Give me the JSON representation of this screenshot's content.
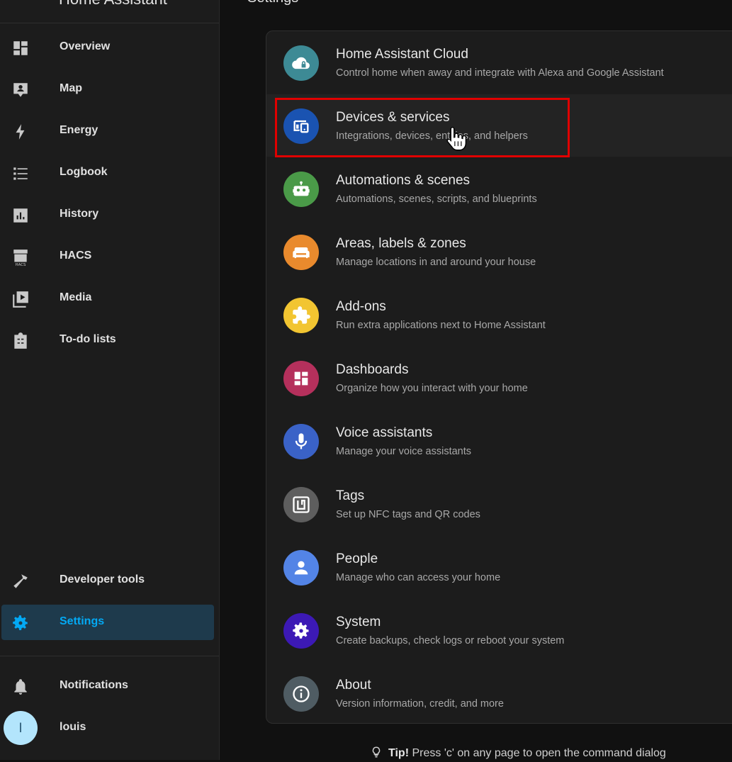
{
  "sidebar": {
    "title": "Home Assistant",
    "items": [
      {
        "label": "Overview",
        "icon": "dashboard-icon"
      },
      {
        "label": "Map",
        "icon": "map-icon"
      },
      {
        "label": "Energy",
        "icon": "lightning-icon"
      },
      {
        "label": "Logbook",
        "icon": "logbook-icon"
      },
      {
        "label": "History",
        "icon": "chart-icon"
      },
      {
        "label": "HACS",
        "icon": "hacs-icon"
      },
      {
        "label": "Media",
        "icon": "media-icon"
      },
      {
        "label": "To-do lists",
        "icon": "clipboard-list-icon"
      }
    ],
    "developer_tools": "Developer tools",
    "settings": "Settings",
    "notifications": "Notifications",
    "user": {
      "initial": "l",
      "name": "louis"
    }
  },
  "header": {
    "title": "Settings"
  },
  "settings_rows": [
    {
      "title": "Home Assistant Cloud",
      "subtitle": "Control home when away and integrate with Alexa and Google Assistant",
      "color": "#3d8a95",
      "icon": "cloud-lock-icon"
    },
    {
      "title": "Devices & services",
      "subtitle": "Integrations, devices, entities, and helpers",
      "color": "#1a53b1",
      "icon": "devices-icon"
    },
    {
      "title": "Automations & scenes",
      "subtitle": "Automations, scenes, scripts, and blueprints",
      "color": "#4a9a48",
      "icon": "robot-icon"
    },
    {
      "title": "Areas, labels & zones",
      "subtitle": "Manage locations in and around your house",
      "color": "#e98a2d",
      "icon": "sofa-icon"
    },
    {
      "title": "Add-ons",
      "subtitle": "Run extra applications next to Home Assistant",
      "color": "#f2c531",
      "icon": "puzzle-icon"
    },
    {
      "title": "Dashboards",
      "subtitle": "Organize how you interact with your home",
      "color": "#b5305c",
      "icon": "dashboard-icon"
    },
    {
      "title": "Voice assistants",
      "subtitle": "Manage your voice assistants",
      "color": "#3a62c7",
      "icon": "microphone-icon"
    },
    {
      "title": "Tags",
      "subtitle": "Set up NFC tags and QR codes",
      "color": "#5e5e5e",
      "icon": "nfc-icon"
    },
    {
      "title": "People",
      "subtitle": "Manage who can access your home",
      "color": "#5384e6",
      "icon": "person-icon"
    },
    {
      "title": "System",
      "subtitle": "Create backups, check logs or reboot your system",
      "color": "#3c19b5",
      "icon": "gear-icon"
    },
    {
      "title": "About",
      "subtitle": "Version information, credit, and more",
      "color": "#4f5c63",
      "icon": "info-icon"
    }
  ],
  "tip": {
    "label": "Tip!",
    "text": "Press 'c' on any page to open the command dialog"
  }
}
